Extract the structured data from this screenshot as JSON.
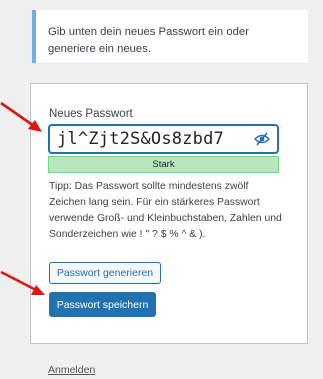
{
  "notice": {
    "text": "Gib unten dein neues Passwort ein oder generiere ein neues."
  },
  "form": {
    "password_label": "Neues Passwort",
    "password_value": "jl^Zjt2S&Os8zbd7",
    "strength": "Stark",
    "hint": "Tipp: Das Passwort sollte mindestens zwölf Zeichen lang sein. Für ein stärkeres Passwort verwende Groß- und Kleinbuchstaben, Zahlen und Sonderzeichen wie ! \" ? $ % ^ & ).",
    "generate_label": "Passwort generieren",
    "save_label": "Passwort speichern",
    "visibility_icon": "eye-slash-icon"
  },
  "footer": {
    "login_link": "Anmelden"
  },
  "colors": {
    "accent": "#2271b1",
    "strong": "#b8e6bf",
    "annotation_arrow": "#e2140e",
    "notice_border": "#72aee6"
  }
}
